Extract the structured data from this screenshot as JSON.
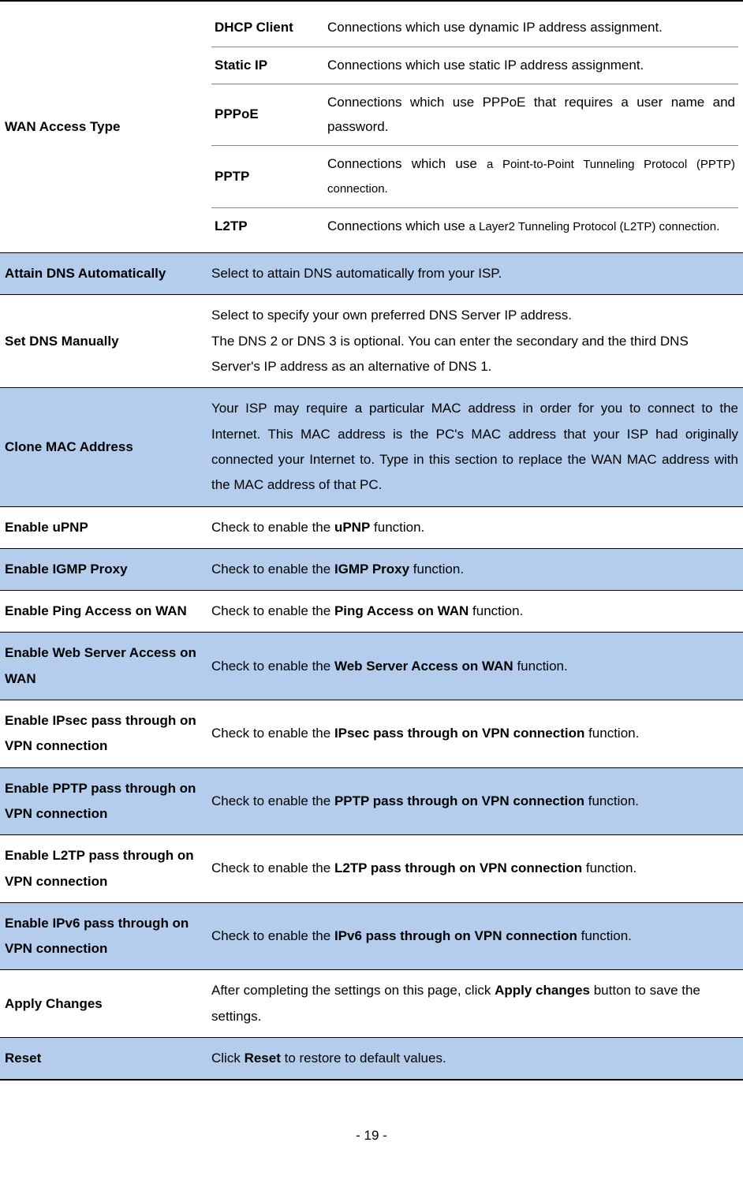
{
  "wanAccess": {
    "label": "WAN Access Type",
    "rows": [
      {
        "name": "DHCP Client",
        "desc": "Connections which use dynamic IP address assignment."
      },
      {
        "name": "Static IP",
        "desc": "Connections which use static IP address assignment."
      },
      {
        "name": "PPPoE",
        "desc": "Connections which use PPPoE that requires a user name and password."
      },
      {
        "name": "PPTP",
        "desc_pre": "Connections which use ",
        "desc_small": "a Point-to-Point Tunneling Protocol (PPTP) connection."
      },
      {
        "name": "L2TP",
        "desc_pre": "Connections which use ",
        "desc_small": "a Layer2 Tunneling Protocol (L2TP) connection."
      }
    ]
  },
  "rows": {
    "attainDns": {
      "label": "Attain DNS Automatically",
      "desc": "Select to attain DNS automatically from your ISP."
    },
    "setDns": {
      "label": "Set DNS Manually",
      "desc": "Select to specify your own preferred DNS Server IP address.\nThe DNS 2 or DNS 3 is optional. You can enter the secondary and the third DNS Server's IP address as an alternative of DNS 1."
    },
    "cloneMac": {
      "label": "Clone MAC Address",
      "desc": "Your ISP may require a particular MAC address in order for you to connect to the Internet. This MAC address is the PC's MAC address that your ISP had originally connected your Internet to. Type in this section to replace the WAN MAC address with the MAC address of that PC."
    },
    "upnp": {
      "label": "Enable uPNP",
      "pre": "Check to enable the ",
      "bold": "uPNP",
      "post": " function."
    },
    "igmp": {
      "label": "Enable IGMP Proxy",
      "pre": "Check to enable the ",
      "bold": "IGMP Proxy",
      "post": " function."
    },
    "pingWan": {
      "label": "Enable Ping Access on WAN",
      "pre": "Check to enable the ",
      "bold": "Ping Access on WAN",
      "post": " function."
    },
    "webWan": {
      "label": "Enable Web Server Access on WAN",
      "pre": "Check to enable the ",
      "bold": "Web Server Access on WAN",
      "post": " function."
    },
    "ipsec": {
      "label": "Enable IPsec pass through on VPN connection",
      "pre": "Check to enable the ",
      "bold": "IPsec pass through on VPN connection",
      "post": " function."
    },
    "pptp": {
      "label": "Enable PPTP pass through on VPN connection",
      "pre": "Check to enable the ",
      "bold": "PPTP pass through on VPN connection",
      "post": " function."
    },
    "l2tp": {
      "label": "Enable L2TP pass through on VPN connection",
      "pre": "Check to enable the ",
      "bold": "L2TP pass through on VPN connection",
      "post": " function."
    },
    "ipv6": {
      "label": "Enable IPv6 pass through on VPN connection",
      "pre": "Check to enable the ",
      "bold": "IPv6 pass through on VPN connection",
      "post": " function."
    },
    "apply": {
      "label": "Apply Changes",
      "pre": "After completing the settings on this page, click ",
      "bold": "Apply changes",
      "post": " button to save the settings."
    },
    "reset": {
      "label": "Reset",
      "pre": "Click ",
      "bold": "Reset",
      "post": " to restore to default values."
    }
  },
  "pageNumber": "- 19 -"
}
